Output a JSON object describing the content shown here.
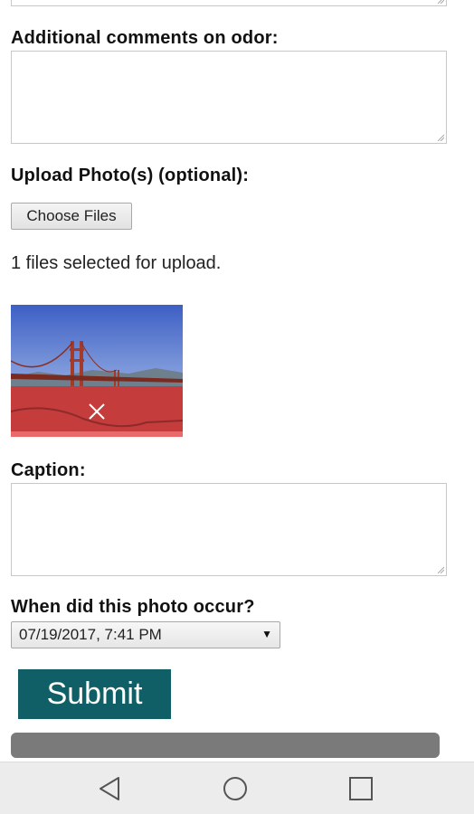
{
  "form": {
    "odor_comments_label": "Additional comments on odor:",
    "odor_comments_value": "",
    "upload_label": "Upload Photo(s) (optional):",
    "choose_files_label": "Choose Files",
    "files_status": "1 files selected for upload.",
    "caption_label": "Caption:",
    "caption_value": "",
    "photo_date_label": "When did this photo occur?",
    "photo_date_value": "07/19/2017, 7:41 PM",
    "submit_label": "Submit",
    "upload_progress": 1.0
  },
  "colors": {
    "submit_bg": "#115f66",
    "thumb_overlay": "#d03c3c",
    "progress_bar": "#7a7a7a",
    "navbar_bg": "#ececec"
  },
  "icons": {
    "remove_photo": "close-icon",
    "nav_back": "back-triangle-icon",
    "nav_home": "home-circle-icon",
    "nav_recents": "recents-square-icon"
  }
}
